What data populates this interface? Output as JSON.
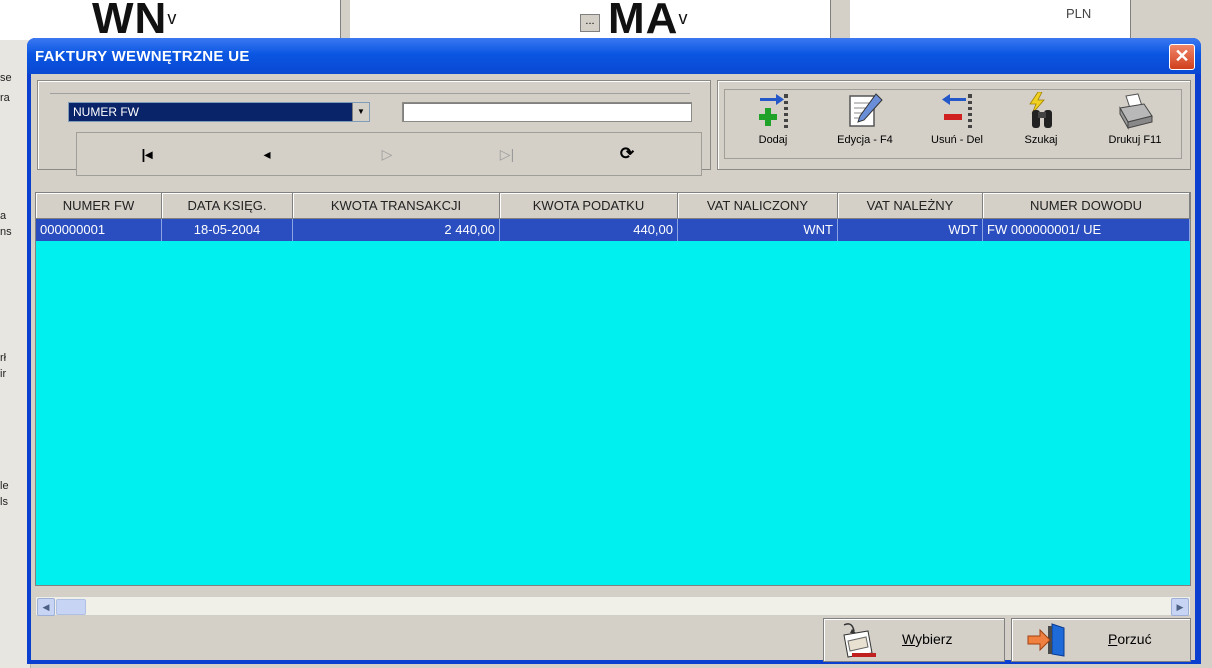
{
  "background_app": {
    "field1": "WN",
    "field1_suffix": "v",
    "field2": "MA",
    "field2_suffix": "v",
    "field2_btn": "...",
    "currency": "PLN",
    "left_fragments": [
      "se",
      "ra",
      "a",
      "ns",
      "rł",
      "ir",
      "le",
      "ls"
    ]
  },
  "window": {
    "title": "FAKTURY WEWNĘTRZNE UE",
    "close_glyph": "✕"
  },
  "search": {
    "field_selected": "NUMER FW",
    "input_value": ""
  },
  "nav": {
    "first": "|◂",
    "prev": "◂",
    "next": "▷",
    "last": "▷|",
    "refresh": "⟳"
  },
  "toolbar": {
    "add": "Dodaj",
    "edit": "Edycja - F4",
    "delete": "Usuń - Del",
    "search": "Szukaj",
    "print": "Drukuj F11"
  },
  "grid": {
    "columns": [
      "NUMER FW",
      "DATA KSIĘG.",
      "KWOTA TRANSAKCJI",
      "KWOTA PODATKU",
      "VAT NALICZONY",
      "VAT NALEŻNY",
      "NUMER DOWODU"
    ],
    "rows": [
      [
        "000000001",
        "18-05-2004",
        "2 440,00",
        "440,00",
        "WNT",
        "WDT",
        "FW 000000001/ UE"
      ]
    ]
  },
  "buttons": {
    "select_u": "W",
    "select_rest": "ybierz",
    "cancel_u": "P",
    "cancel_rest": "orzuć"
  },
  "colors": {
    "grid_background": "#00f0f0",
    "selected_row": "#2a4ec0",
    "title_bar": "#0a56e2"
  }
}
